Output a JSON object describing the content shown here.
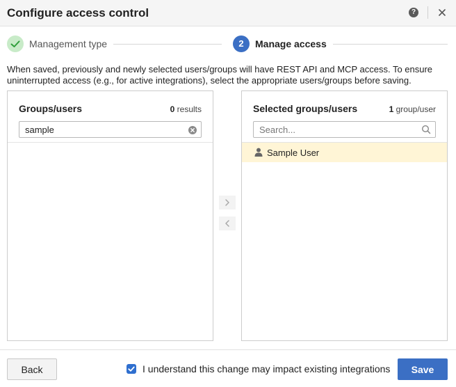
{
  "dialog": {
    "title": "Configure access control",
    "help_icon": "help-icon",
    "help_glyph": "?",
    "close_icon": "close-icon"
  },
  "steps": [
    {
      "label": "Management type",
      "state": "completed",
      "icon": "checkmark-icon"
    },
    {
      "number": "2",
      "label": "Manage access",
      "state": "active"
    }
  ],
  "info_text": "When saved, previously and newly selected users/groups will have REST API and MCP access. To ensure uninterrupted access (e.g., for active integrations), select the appropriate users/groups before saving.",
  "left_panel": {
    "title": "Groups/users",
    "count": "0",
    "count_suffix": " results",
    "search_value": "sample",
    "clear_icon": "clear-icon",
    "items": []
  },
  "right_panel": {
    "title": "Selected groups/users",
    "count": "1",
    "count_suffix": " group/user",
    "search_placeholder": "Search...",
    "search_icon": "search-icon",
    "items": [
      {
        "label": "Sample User",
        "icon": "user-icon",
        "highlighted": true
      }
    ]
  },
  "transfer": {
    "move_right_icon": "chevron-right-icon",
    "move_left_icon": "chevron-left-icon"
  },
  "footer": {
    "back_label": "Back",
    "checkbox_checked": true,
    "checkbox_label": "I understand this change may impact existing integrations",
    "save_label": "Save"
  },
  "colors": {
    "primary": "#3b6fc4",
    "checkbox": "#2f6fcf",
    "completed_step_bg": "#c8ebc8",
    "completed_check": "#2e9e3a",
    "highlight_row": "#fff5d6",
    "header_bg": "#f5f5f5"
  }
}
